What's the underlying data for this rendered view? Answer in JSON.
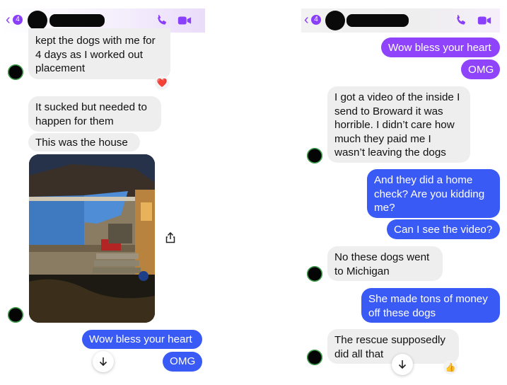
{
  "left": {
    "header": {
      "back_glyph": "‹",
      "badge": "4"
    },
    "messages": [
      {
        "dir": "in",
        "text": "kept the dogs with me for\n4 days as I worked out\nplacement"
      },
      {
        "dir": "in",
        "text": "It sucked but needed to\nhappen for them"
      },
      {
        "dir": "in",
        "text": "This was the house"
      },
      {
        "dir": "out",
        "text": "Wow bless your heart"
      },
      {
        "dir": "out",
        "text": "OMG"
      }
    ],
    "reaction": "❤️",
    "photo_alt": "house at night with blue tarp on porch"
  },
  "right": {
    "header": {
      "back_glyph": "‹",
      "badge": "4"
    },
    "messages": [
      {
        "dir": "out",
        "text": "Wow bless your heart"
      },
      {
        "dir": "out",
        "text": "OMG"
      },
      {
        "dir": "in",
        "text": "I got a video of the inside I\nsend to Broward it was\nhorrible. I didn’t care how\nmuch they paid me I\nwasn’t leaving the dogs"
      },
      {
        "dir": "out",
        "text": "And they did a home\ncheck?  Are you kidding\nme?"
      },
      {
        "dir": "out",
        "text": "Can I see the video?"
      },
      {
        "dir": "in",
        "text": "No these dogs went\nto Michigan"
      },
      {
        "dir": "out",
        "text": "She made tons of money\noff these dogs"
      },
      {
        "dir": "in",
        "text": "The rescue supposedly\ndid all that"
      }
    ],
    "reaction": "👍"
  },
  "icons": {
    "phone": "phone-icon",
    "video": "video-camera-icon",
    "share": "share-icon",
    "scroll_down": "arrow-down-icon"
  },
  "colors": {
    "accent": "#8a3ffc",
    "outgoing_blue": "#3a5af5",
    "outgoing_purple": "#8f44fb",
    "incoming": "#eeeeee"
  }
}
